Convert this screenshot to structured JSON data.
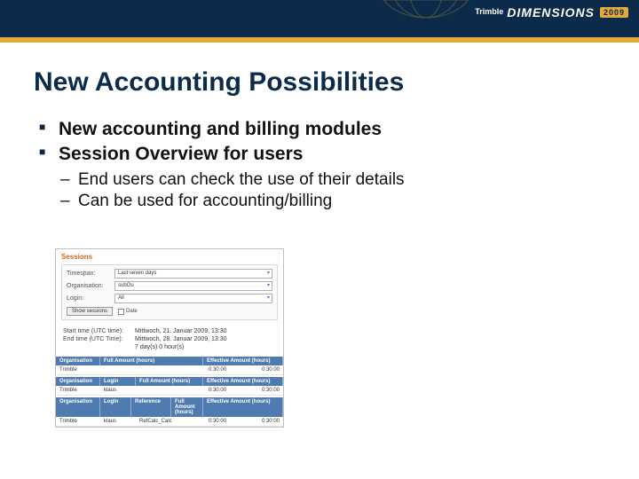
{
  "logo": {
    "brand": "Trimble",
    "word": "DIMENSIONS",
    "year": "2009"
  },
  "title": "New Accounting Possibilities",
  "bullets": [
    "New accounting and billing modules",
    "Session Overview for users"
  ],
  "sub_bullets": [
    "End users can check the use of their details",
    "Can be used for accounting/billing"
  ],
  "screenshot": {
    "panel_title": "Sessions",
    "form": {
      "timespan_label": "Timespan:",
      "timespan_value": "Last seven days",
      "org_label": "Organisation:",
      "org_value": "subOu",
      "login_label": "Login:",
      "login_value": "All",
      "button": "Show sessions",
      "checkbox": "Date"
    },
    "times": {
      "start_label": "Start time (UTC time):",
      "start_value": "Mittwoch, 21. Januar 2009, 13:30",
      "end_label": "End time (UTC Time):",
      "end_value": "Mittwoch, 28. Januar 2009, 13:30",
      "duration": "7 day(s) 0 hour(s)"
    },
    "section1": {
      "headers": [
        "Organisation",
        "Full Amount (hours)",
        "Effective Amount (hours)"
      ],
      "row": [
        "Trimble",
        "0:30:00",
        "0:30:00"
      ]
    },
    "section2": {
      "headers": [
        "Organisation",
        "Login",
        "Full Amount (hours)",
        "Effective Amount (hours)"
      ],
      "row": [
        "Trimble",
        "klaus",
        "0:30:00",
        "0:30:00"
      ]
    },
    "section3": {
      "headers": [
        "Organisation",
        "Login",
        "Reference",
        "Full Amount (hours)",
        "Effective Amount (hours)"
      ],
      "row": [
        "Trimble",
        "klaus",
        "RefCalc_Calc",
        "0:30:00",
        "0:30:00"
      ]
    }
  }
}
